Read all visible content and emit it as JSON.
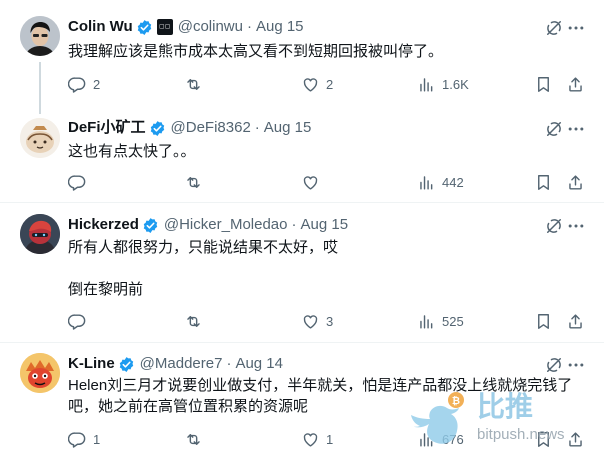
{
  "tweets": [
    {
      "name": "Colin Wu",
      "handle": "@colinwu",
      "date": "Aug 15",
      "text": "我理解应该是熊市成本太高又看不到短期回报被叫停了。",
      "replies": "2",
      "retweets": "",
      "likes": "2",
      "views": "1.6K",
      "has_affiliate_badge": true
    },
    {
      "name": "DeFi小矿工",
      "handle": "@DeFi8362",
      "date": "Aug 15",
      "text": "这也有点太快了。。",
      "replies": "",
      "retweets": "",
      "likes": "",
      "views": "442"
    },
    {
      "name": "Hickerzed",
      "handle": "@Hicker_Moledao",
      "date": "Aug 15",
      "text_line1": "所有人都很努力，只能说结果不太好，哎",
      "text_line2": "倒在黎明前",
      "replies": "",
      "retweets": "",
      "likes": "3",
      "views": "525"
    },
    {
      "name": "K-Line",
      "handle": "@Maddere7",
      "date": "Aug 14",
      "text_line1": "Helen刘三月才说要创业做支付，半年就关，怕是连产品都没上线就烧完钱了",
      "text_line2": "吧，她之前在高管位置积累的资源呢",
      "replies": "1",
      "retweets": "",
      "likes": "1",
      "views": "676"
    }
  ],
  "separator": "·",
  "watermark": {
    "cn": "比推",
    "en": "bitpush.news"
  },
  "colors": {
    "verified": "#1d9bf0",
    "secondary_text": "#536471",
    "divider": "#eff3f4"
  }
}
